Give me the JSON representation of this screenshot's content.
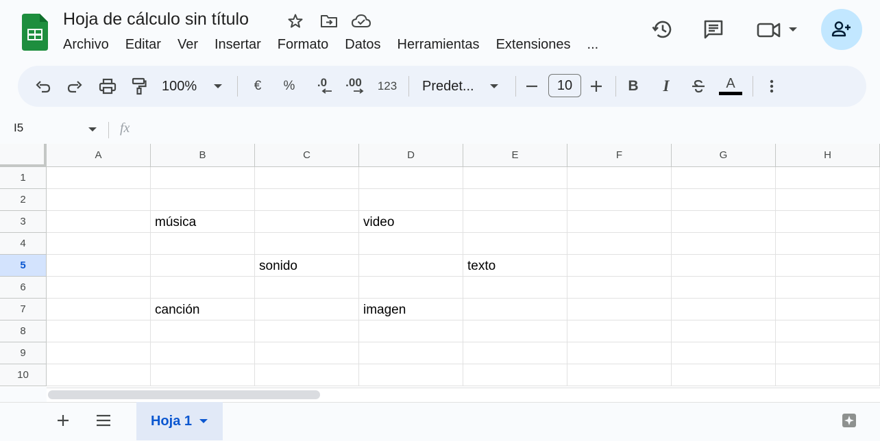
{
  "header": {
    "title": "Hoja de cálculo sin título",
    "menu": [
      "Archivo",
      "Editar",
      "Ver",
      "Insertar",
      "Formato",
      "Datos",
      "Herramientas",
      "Extensiones",
      "..."
    ],
    "accent": "#1e8e3e",
    "share_bg": "#c2e7ff"
  },
  "toolbar": {
    "zoom": "100%",
    "currency": "€",
    "percent": "%",
    "dec_decrease": ".0",
    "dec_increase": ".00",
    "number_format": "123",
    "font": "Predet...",
    "font_size": "10",
    "bold": "B",
    "italic": "I",
    "text_color_label": "A"
  },
  "formula_bar": {
    "name_box": "I5",
    "fx": "fx"
  },
  "grid": {
    "columns": [
      "A",
      "B",
      "C",
      "D",
      "E",
      "F",
      "G",
      "H"
    ],
    "rows": [
      "1",
      "2",
      "3",
      "4",
      "5",
      "6",
      "7",
      "8",
      "9",
      "10"
    ],
    "selected_row": "5",
    "cells": {
      "B3": "música",
      "D3": "video",
      "C5": "sonido",
      "E5": "texto",
      "B7": "canción",
      "D7": "imagen"
    }
  },
  "sheets": {
    "active_tab": "Hoja 1"
  }
}
